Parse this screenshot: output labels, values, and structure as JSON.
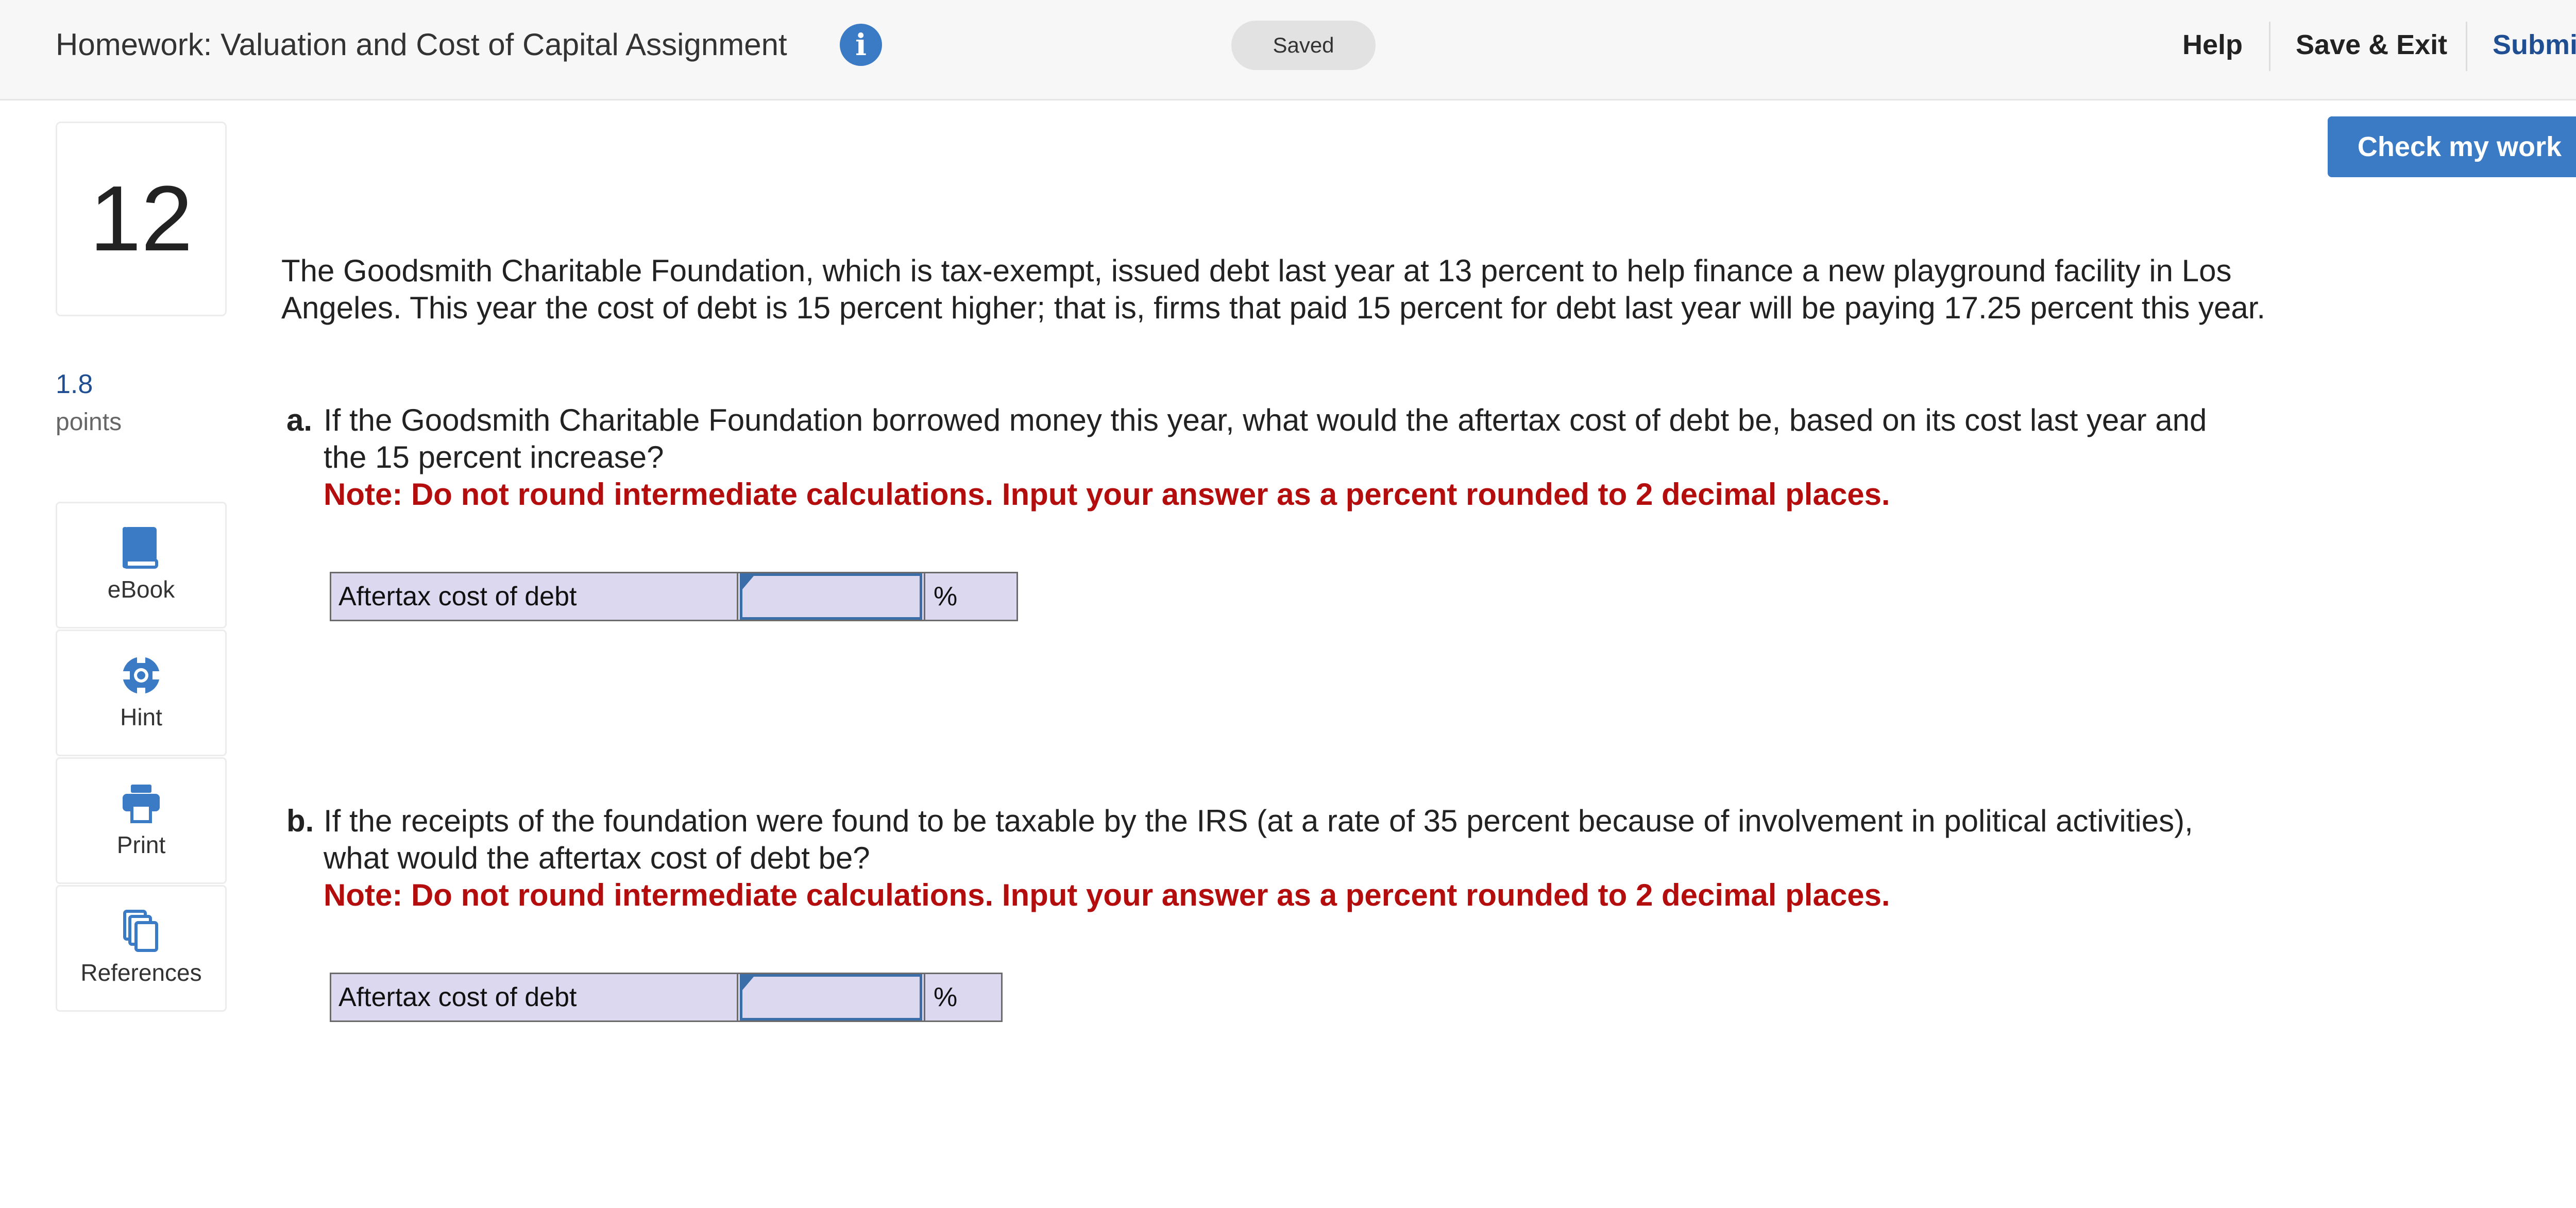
{
  "header": {
    "title": "Homework: Valuation and Cost of Capital Assignment",
    "saved_label": "Saved",
    "help": "Help",
    "save_exit": "Save & Exit",
    "submit": "Submit"
  },
  "question": {
    "number": "12",
    "points_value": "1.8",
    "points_label": "points"
  },
  "tools": {
    "ebook": "eBook",
    "hint": "Hint",
    "print": "Print",
    "references": "References"
  },
  "check_button": "Check my work",
  "intro": "The Goodsmith Charitable Foundation, which is tax-exempt, issued debt last year at 13 percent to help finance a new playground facility in Los Angeles. This year the cost of debt is 15 percent higher; that is, firms that paid 15 percent for debt last year will be paying 17.25 percent this year.",
  "part_a": {
    "letter": "a.",
    "text": "If the Goodsmith Charitable Foundation borrowed money this year, what would the aftertax cost of debt be, based on its cost last year and the 15 percent increase?",
    "note": "Note: Do not round intermediate calculations. Input your answer as a percent rounded to 2 decimal places.",
    "answer_label": "Aftertax cost of debt",
    "answer_value": "",
    "unit": "%"
  },
  "part_b": {
    "letter": "b.",
    "text": "If the receipts of the foundation were found to be taxable by the IRS (at a rate of 35 percent because of involvement in political activities), what would the aftertax cost of debt be?",
    "note": "Note: Do not round intermediate calculations. Input your answer as a percent rounded to 2 decimal places.",
    "answer_label": "Aftertax cost of debt",
    "answer_value": "",
    "unit": "%"
  },
  "colors": {
    "accent": "#3b7ac4",
    "brand_dark": "#1f4f92",
    "note_red": "#b30d0d",
    "answer_bg": "#dcd8f0"
  }
}
